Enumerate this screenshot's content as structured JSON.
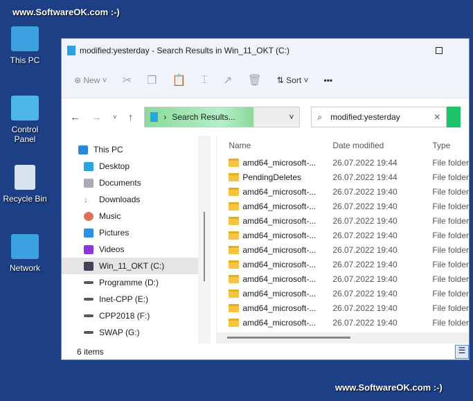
{
  "watermark": {
    "top": "www.SoftwareOK.com :-)",
    "bottom": "www.SoftwareOK.com :-)"
  },
  "desktop": [
    {
      "label": "This PC"
    },
    {
      "label": "Control Panel"
    },
    {
      "label": "Recycle Bin"
    },
    {
      "label": "Network"
    }
  ],
  "window": {
    "title": "modified:yesterday - Search Results in Win_11_OKT (C:)"
  },
  "toolbar": {
    "new": "New",
    "sort": "Sort",
    "more": "•••"
  },
  "address": {
    "crumb": "Search Results...",
    "search_value": "modified:yesterday"
  },
  "sidebar": [
    {
      "label": "This PC"
    },
    {
      "label": "Desktop"
    },
    {
      "label": "Documents"
    },
    {
      "label": "Downloads"
    },
    {
      "label": "Music"
    },
    {
      "label": "Pictures"
    },
    {
      "label": "Videos"
    },
    {
      "label": "Win_11_OKT (C:)"
    },
    {
      "label": "Programme (D:)"
    },
    {
      "label": "Inet-CPP (E:)"
    },
    {
      "label": "CPP2018 (F:)"
    },
    {
      "label": "SWAP (G:)"
    }
  ],
  "columns": {
    "name": "Name",
    "date": "Date modified",
    "type": "Type"
  },
  "rows": [
    {
      "name": "amd64_microsoft-...",
      "date": "26.07.2022 19:44",
      "type": "File folder"
    },
    {
      "name": "PendingDeletes",
      "date": "26.07.2022 19:44",
      "type": "File folder"
    },
    {
      "name": "amd64_microsoft-...",
      "date": "26.07.2022 19:40",
      "type": "File folder"
    },
    {
      "name": "amd64_microsoft-...",
      "date": "26.07.2022 19:40",
      "type": "File folder"
    },
    {
      "name": "amd64_microsoft-...",
      "date": "26.07.2022 19:40",
      "type": "File folder"
    },
    {
      "name": "amd64_microsoft-...",
      "date": "26.07.2022 19:40",
      "type": "File folder"
    },
    {
      "name": "amd64_microsoft-...",
      "date": "26.07.2022 19:40",
      "type": "File folder"
    },
    {
      "name": "amd64_microsoft-...",
      "date": "26.07.2022 19:40",
      "type": "File folder"
    },
    {
      "name": "amd64_microsoft-...",
      "date": "26.07.2022 19:40",
      "type": "File folder"
    },
    {
      "name": "amd64_microsoft-...",
      "date": "26.07.2022 19:40",
      "type": "File folder"
    },
    {
      "name": "amd64_microsoft-...",
      "date": "26.07.2022 19:40",
      "type": "File folder"
    },
    {
      "name": "amd64_microsoft-...",
      "date": "26.07.2022 19:40",
      "type": "File folder"
    }
  ],
  "status": {
    "items": "6 items"
  }
}
